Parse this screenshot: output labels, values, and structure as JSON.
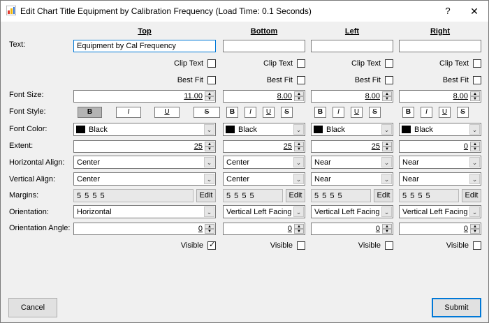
{
  "window": {
    "title": "Edit Chart Title Equipment by Calibration Frequency (Load Time: 0.1 Seconds)",
    "help_glyph": "?",
    "close_glyph": "✕"
  },
  "labels": {
    "text": "Text:",
    "font_size": "Font Size:",
    "font_style": "Font Style:",
    "font_color": "Font Color:",
    "extent": "Extent:",
    "horizontal_align": "Horizontal Align:",
    "vertical_align": "Vertical Align:",
    "margins": "Margins:",
    "orientation": "Orientation:",
    "orientation_angle": "Orientation Angle:"
  },
  "common": {
    "clip_text": "Clip Text",
    "best_fit": "Best Fit",
    "visible": "Visible",
    "edit": "Edit",
    "bold": "B",
    "italic": "I",
    "underline": "U",
    "strike": "S",
    "check_glyph": "✓",
    "spin_up": "▲",
    "spin_down": "▼",
    "dropdown_glyph": "⌄"
  },
  "columns": [
    {
      "header": "Top",
      "text": "Equipment by Cal Frequency",
      "clip_text": false,
      "best_fit": false,
      "font_size": "11.00",
      "bold_active": true,
      "font_color": "Black",
      "extent": "25",
      "horizontal_align": "Center",
      "vertical_align": "Center",
      "margins": "5 5 5 5",
      "orientation": "Horizontal",
      "orientation_angle": "0",
      "visible": true
    },
    {
      "header": "Bottom",
      "text": "",
      "clip_text": false,
      "best_fit": false,
      "font_size": "8.00",
      "bold_active": false,
      "font_color": "Black",
      "extent": "25",
      "horizontal_align": "Center",
      "vertical_align": "Center",
      "margins": "5 5 5 5",
      "orientation": "Vertical Left Facing",
      "orientation_angle": "0",
      "visible": false
    },
    {
      "header": "Left",
      "text": "",
      "clip_text": false,
      "best_fit": false,
      "font_size": "8.00",
      "bold_active": false,
      "font_color": "Black",
      "extent": "25",
      "horizontal_align": "Near",
      "vertical_align": "Near",
      "margins": "5 5 5 5",
      "orientation": "Vertical Left Facing",
      "orientation_angle": "0",
      "visible": false
    },
    {
      "header": "Right",
      "text": "",
      "clip_text": false,
      "best_fit": false,
      "font_size": "8.00",
      "bold_active": false,
      "font_color": "Black",
      "extent": "0",
      "horizontal_align": "Near",
      "vertical_align": "Near",
      "margins": "5 5 5 5",
      "orientation": "Vertical Left Facing",
      "orientation_angle": "0",
      "visible": false
    }
  ],
  "buttons": {
    "cancel": "Cancel",
    "submit": "Submit"
  },
  "colors": {
    "accent": "#0078d7",
    "font_color_swatch": "#000000"
  }
}
